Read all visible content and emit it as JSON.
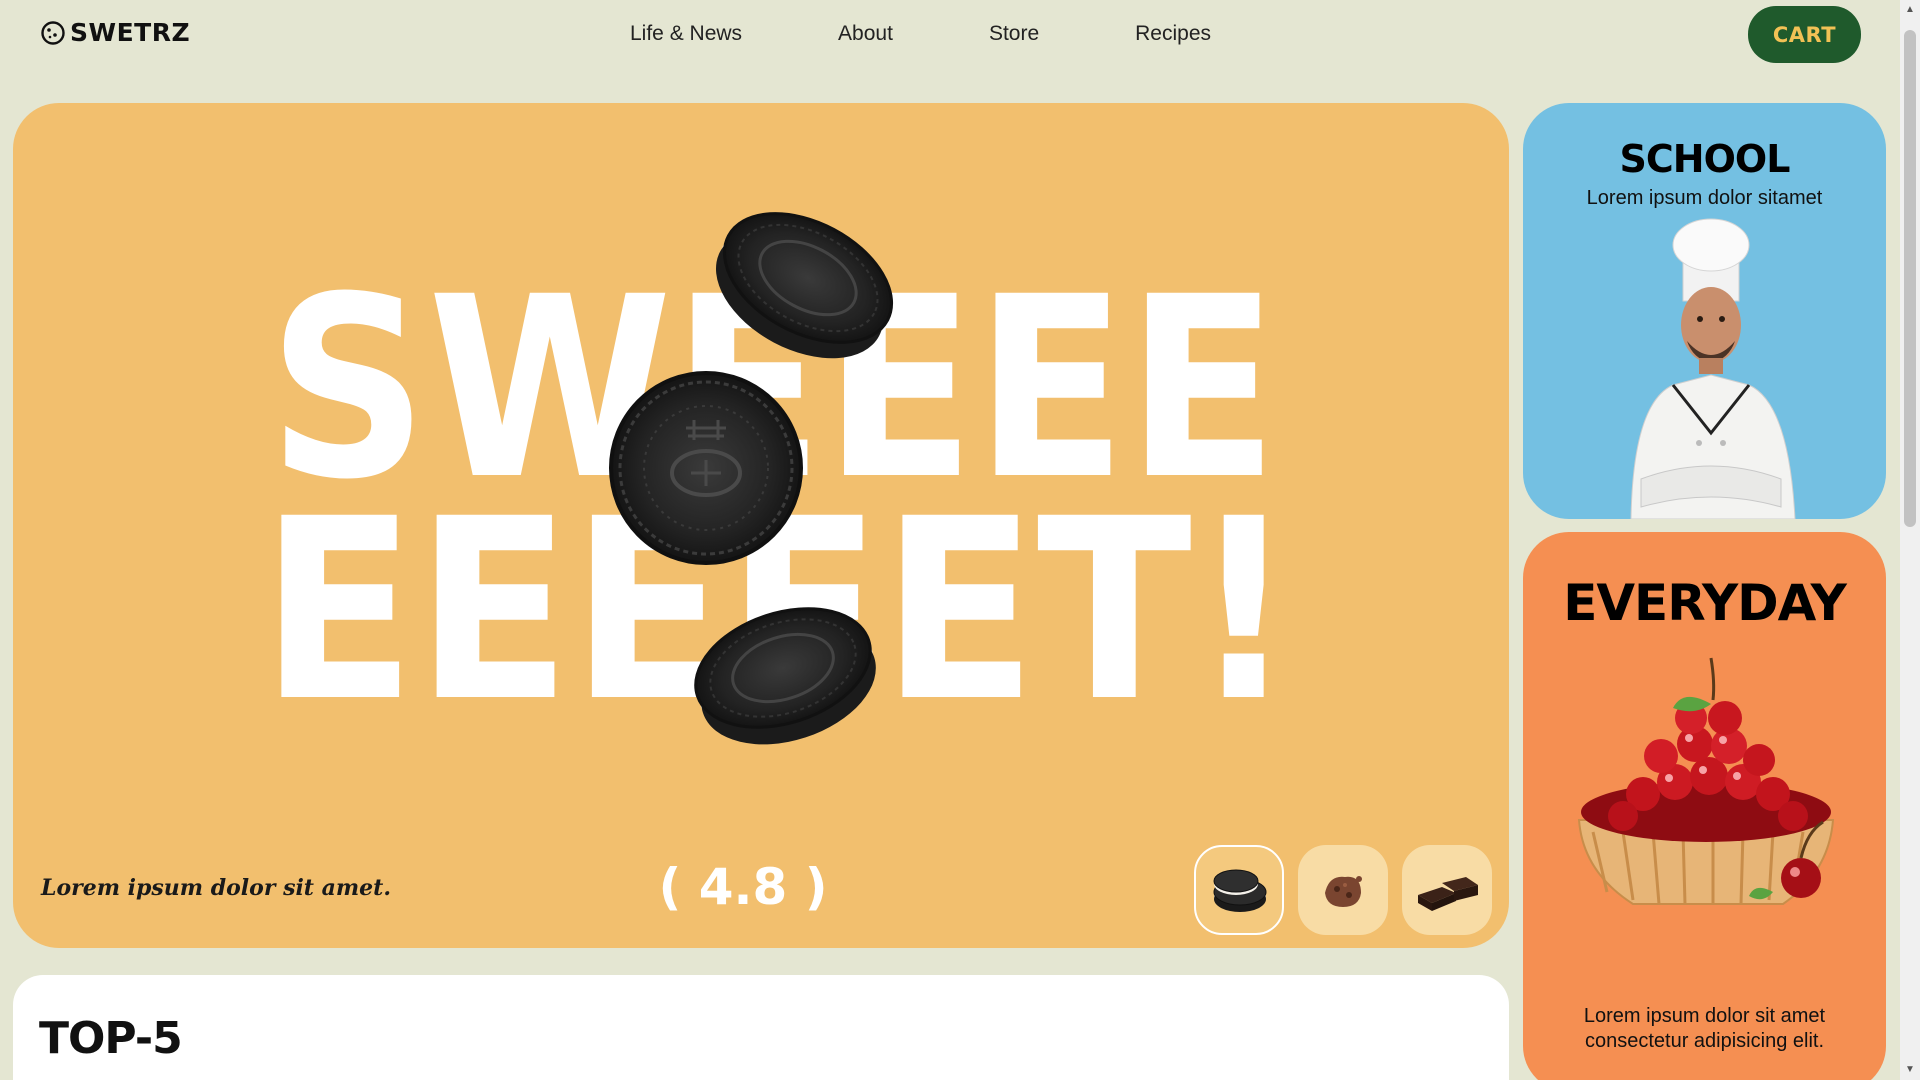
{
  "header": {
    "logo_text": "SWETRZ",
    "nav": [
      "Life & News",
      "About",
      "Store",
      "Recipes"
    ],
    "cart_label": "CART"
  },
  "hero": {
    "headline_line1": "SWEEEE",
    "headline_line2": "EEEEET!",
    "caption": "Lorem ipsum dolor sit amet.",
    "rating": "( 4.8 )",
    "thumbnails": [
      "oreo-cookies-icon",
      "cookie-crumble-icon",
      "brownies-icon"
    ]
  },
  "school_card": {
    "title": "SCHOOL",
    "subtitle": "Lorem ipsum dolor sitamet"
  },
  "everyday_card": {
    "title": "EVERYDAY",
    "subtitle": "Lorem ipsum dolor sit amet consectetur adipisicing elit."
  },
  "top5": {
    "title": "TOP-5"
  },
  "colors": {
    "page_bg": "#e4e6d2",
    "hero_bg": "#f2bf6e",
    "school_bg": "#74c0e2",
    "everyday_bg": "#f58f52",
    "cart_bg": "#1f5a2c",
    "cart_text": "#f2c155"
  }
}
